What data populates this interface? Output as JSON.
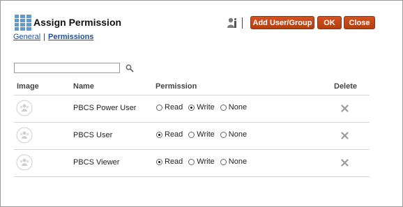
{
  "header": {
    "title": "Assign Permission",
    "subnav": {
      "general": "General",
      "separator": "|",
      "permissions": "Permissions"
    },
    "buttons": {
      "add": "Add User/Group",
      "ok": "OK",
      "close": "Close"
    }
  },
  "search": {
    "value": "",
    "placeholder": ""
  },
  "table": {
    "columns": {
      "image": "Image",
      "name": "Name",
      "permission": "Permission",
      "delete": "Delete"
    },
    "options": {
      "read": "Read",
      "write": "Write",
      "none": "None"
    },
    "rows": [
      {
        "name": "PBCS Power User",
        "permission": "Write"
      },
      {
        "name": "PBCS User",
        "permission": "Read"
      },
      {
        "name": "PBCS Viewer",
        "permission": "Read"
      }
    ]
  },
  "colors": {
    "accent": "#c4481a",
    "link": "#1f4e99",
    "icon": "#5b9bd5"
  },
  "icons": [
    "grid-app-icon",
    "user-info-icon",
    "search-icon",
    "group-avatar-icon",
    "delete-x-icon"
  ]
}
